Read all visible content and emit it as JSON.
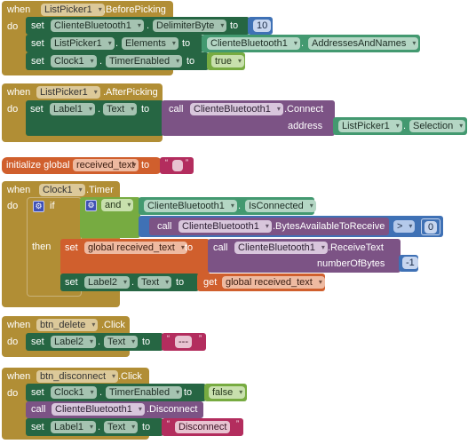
{
  "blocks": {
    "before_picking": {
      "when": "when",
      "component": "ListPicker1",
      "event": ".BeforePicking",
      "do": "do",
      "rows": [
        {
          "set": "set",
          "component": "ClienteBluetooth1",
          "dot": ".",
          "property": "DelimiterByte",
          "to": "to",
          "value": "10"
        },
        {
          "set": "set",
          "component": "ListPicker1",
          "dot": ".",
          "property": "Elements",
          "to": "to",
          "value_component": "ClienteBluetooth1",
          "value_dot": ".",
          "value_property": "AddressesAndNames"
        },
        {
          "set": "set",
          "component": "Clock1",
          "dot": ".",
          "property": "TimerEnabled",
          "to": "to",
          "value": "true"
        }
      ]
    },
    "after_picking": {
      "when": "when",
      "component": "ListPicker1",
      "event": ".AfterPicking",
      "do": "do",
      "set": "set",
      "set_component": "Label1",
      "dot": ".",
      "property": "Text",
      "to": "to",
      "call": "call",
      "call_component": "ClienteBluetooth1",
      "method": ".Connect",
      "arg_name": "address",
      "arg_component": "ListPicker1",
      "arg_dot": ".",
      "arg_property": "Selection"
    },
    "init_global": {
      "label": "initialize global",
      "name": "received_text",
      "to": "to",
      "value": ""
    },
    "clock_timer": {
      "when": "when",
      "component": "Clock1",
      "event": ".Timer",
      "do": "do",
      "if": "if",
      "then": "then",
      "and": "and",
      "cond1_component": "ClienteBluetooth1",
      "cond1_dot": ".",
      "cond1_property": "IsConnected",
      "cond2_call": "call",
      "cond2_component": "ClienteBluetooth1",
      "cond2_method": ".BytesAvailableToReceive",
      "compare_op": ">",
      "compare_value": "0",
      "then_rows": [
        {
          "set": "set",
          "var": "global received_text",
          "to": "to",
          "call": "call",
          "call_component": "ClienteBluetooth1",
          "method": ".ReceiveText",
          "arg_name": "numberOfBytes",
          "arg_value": "-1"
        },
        {
          "set": "set",
          "component": "Label2",
          "dot": ".",
          "property": "Text",
          "to": "to",
          "get": "get",
          "get_var": "global received_text"
        }
      ]
    },
    "btn_delete": {
      "when": "when",
      "component": "btn_delete",
      "event": ".Click",
      "do": "do",
      "set": "set",
      "set_component": "Label2",
      "dot": ".",
      "property": "Text",
      "to": "to",
      "value": "---"
    },
    "btn_disconnect": {
      "when": "when",
      "component": "btn_disconnect",
      "event": ".Click",
      "do": "do",
      "rows": [
        {
          "set": "set",
          "component": "Clock1",
          "dot": ".",
          "property": "TimerEnabled",
          "to": "to",
          "value": "false"
        },
        {
          "call": "call",
          "component": "ClienteBluetooth1",
          "method": ".Disconnect"
        },
        {
          "set": "set",
          "component": "Label1",
          "dot": ".",
          "property": "Text",
          "to": "to",
          "value": "Disconnect"
        }
      ]
    }
  },
  "colors": {
    "event": "#b18e35",
    "setter": "#266643",
    "component": "#439970",
    "call": "#7c5385",
    "logic": "#77ab41",
    "math": "#3f71b5",
    "variable": "#d05f2d",
    "text": "#b32d5e"
  }
}
